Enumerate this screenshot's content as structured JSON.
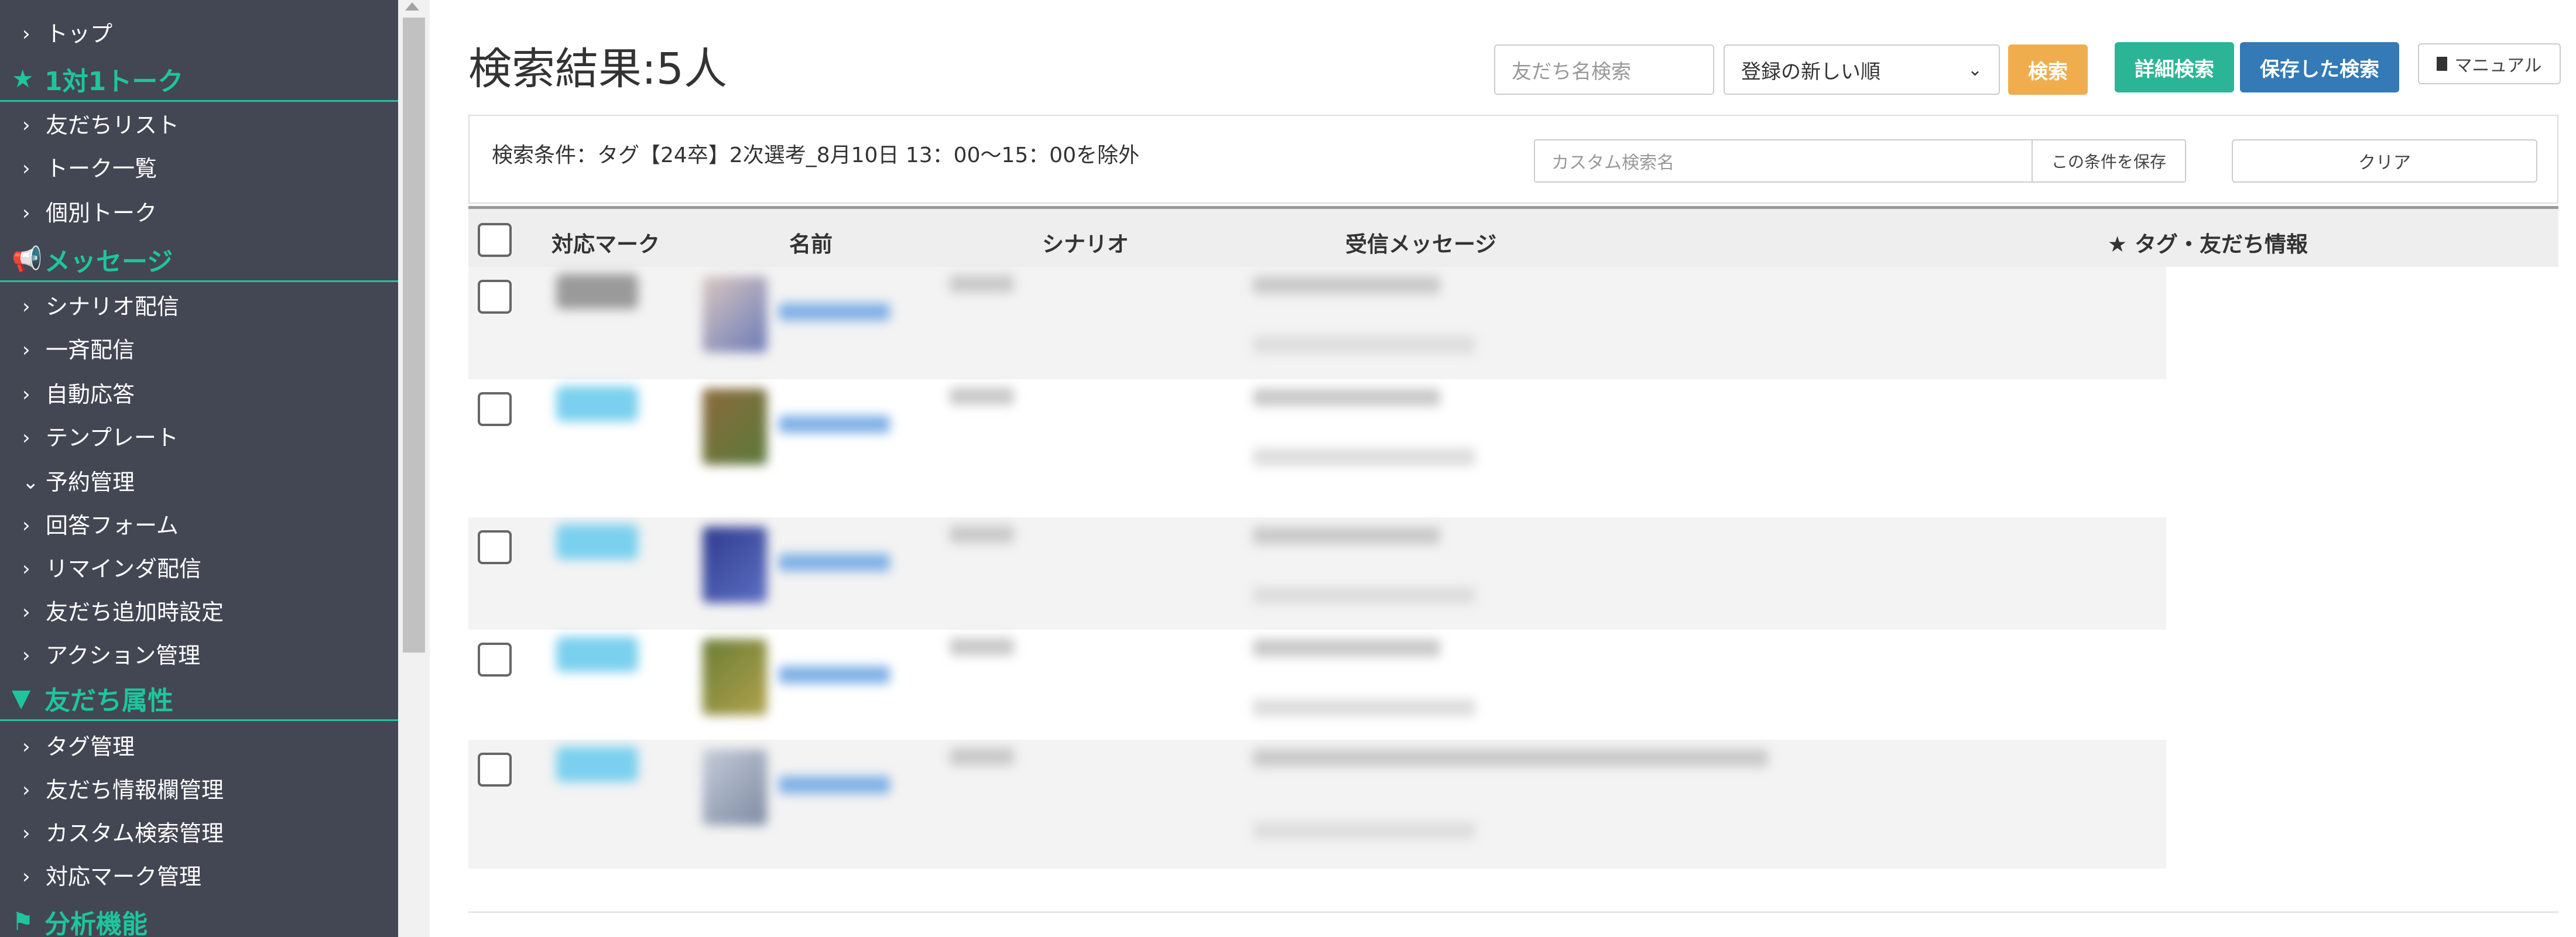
{
  "sidebar": {
    "items": [
      {
        "type": "item",
        "label": "トップ",
        "chevron": "›"
      },
      {
        "type": "section",
        "label": "1対1トーク",
        "icon": "star-icon",
        "glyph": "★"
      },
      {
        "type": "item",
        "label": "友だちリスト",
        "chevron": "›"
      },
      {
        "type": "item",
        "label": "トーク一覧",
        "chevron": "›"
      },
      {
        "type": "item",
        "label": "個別トーク",
        "chevron": "›"
      },
      {
        "type": "section",
        "label": "メッセージ",
        "icon": "megaphone-icon",
        "glyph": "📢"
      },
      {
        "type": "item",
        "label": "シナリオ配信",
        "chevron": "›"
      },
      {
        "type": "item",
        "label": "一斉配信",
        "chevron": "›"
      },
      {
        "type": "item",
        "label": "自動応答",
        "chevron": "›"
      },
      {
        "type": "item",
        "label": "テンプレート",
        "chevron": "›"
      },
      {
        "type": "item",
        "label": "予約管理",
        "chevron": "⌄"
      },
      {
        "type": "item",
        "label": "回答フォーム",
        "chevron": "›"
      },
      {
        "type": "item",
        "label": "リマインダ配信",
        "chevron": "›"
      },
      {
        "type": "item",
        "label": "友だち追加時設定",
        "chevron": "›"
      },
      {
        "type": "item",
        "label": "アクション管理",
        "chevron": "›"
      },
      {
        "type": "section",
        "label": "友だち属性",
        "icon": "filter-icon",
        "glyph": "▼"
      },
      {
        "type": "item",
        "label": "タグ管理",
        "chevron": "›"
      },
      {
        "type": "item",
        "label": "友だち情報欄管理",
        "chevron": "›"
      },
      {
        "type": "item",
        "label": "カスタム検索管理",
        "chevron": "›"
      },
      {
        "type": "item",
        "label": "対応マーク管理",
        "chevron": "›"
      },
      {
        "type": "section",
        "label": "分析機能",
        "icon": "flag-icon",
        "glyph": "⚑"
      }
    ]
  },
  "header": {
    "title": "検索結果:5人",
    "name_search_placeholder": "友だち名検索",
    "sort_selected": "登録の新しい順",
    "search_button": "検索",
    "detail_search_button": "詳細検索",
    "saved_search_button": "保存した検索",
    "manual_button": "マニュアル"
  },
  "conditions": {
    "text": "検索条件：タグ【24卒】2次選考_8月10日 13：00〜15：00を除外",
    "custom_name_placeholder": "カスタム検索名",
    "save_button": "この条件を保存",
    "clear_button": "クリア"
  },
  "table": {
    "columns": [
      "対応マーク",
      "名前",
      "シナリオ",
      "受信メッセージ",
      "★ タグ・友だち情報"
    ]
  },
  "colors": {
    "sidebar_bg": "#434753",
    "accent_green": "#1fc59c",
    "search_orange": "#f0ad4e",
    "detail_teal": "#2bb596",
    "saved_blue": "#337ab7"
  }
}
